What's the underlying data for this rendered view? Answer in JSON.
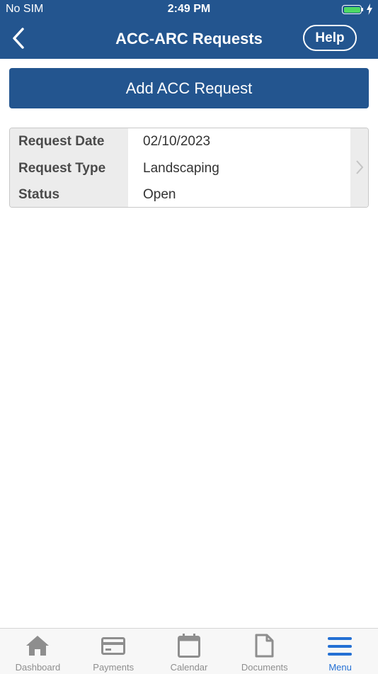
{
  "status_bar": {
    "carrier": "No SIM",
    "time": "2:49 PM"
  },
  "nav": {
    "title": "ACC-ARC Requests",
    "help_label": "Help"
  },
  "add_button_label": "Add ACC Request",
  "request": {
    "rows": [
      {
        "label": "Request Date",
        "value": "02/10/2023"
      },
      {
        "label": "Request Type",
        "value": "Landscaping"
      },
      {
        "label": "Status",
        "value": "Open"
      }
    ]
  },
  "tabbar": {
    "tabs": [
      {
        "label": "Dashboard",
        "icon": "home-icon"
      },
      {
        "label": "Payments",
        "icon": "credit-card-icon"
      },
      {
        "label": "Calendar",
        "icon": "calendar-icon"
      },
      {
        "label": "Documents",
        "icon": "document-icon"
      },
      {
        "label": "Menu",
        "icon": "hamburger-menu-icon",
        "active": true
      }
    ]
  },
  "colors": {
    "primary": "#23558f",
    "active_tab": "#2470d4",
    "inactive_tab": "#8e8e8e",
    "battery": "#4cd964"
  }
}
